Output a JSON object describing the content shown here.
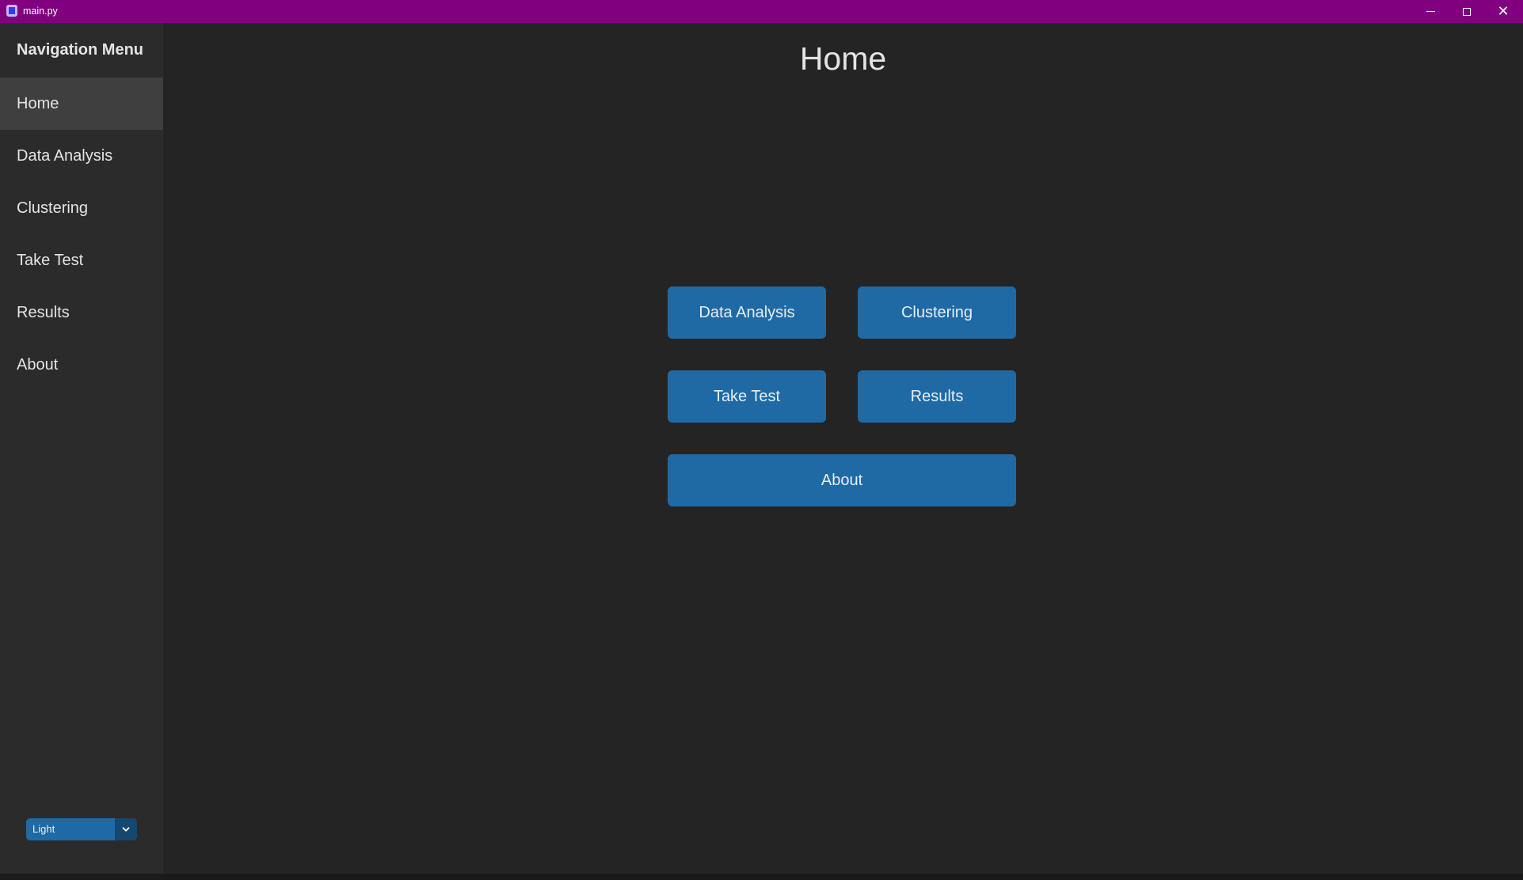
{
  "window": {
    "title": "main.py"
  },
  "sidebar": {
    "title": "Navigation Menu",
    "items": [
      {
        "label": "Home",
        "active": true
      },
      {
        "label": "Data Analysis",
        "active": false
      },
      {
        "label": "Clustering",
        "active": false
      },
      {
        "label": "Take Test",
        "active": false
      },
      {
        "label": "Results",
        "active": false
      },
      {
        "label": "About",
        "active": false
      }
    ],
    "appearance_mode": {
      "selected": "Light",
      "icon": "chevron-down-icon"
    }
  },
  "main": {
    "title": "Home",
    "buttons": {
      "data_analysis": "Data Analysis",
      "clustering": "Clustering",
      "take_test": "Take Test",
      "results": "Results",
      "about": "About"
    }
  },
  "colors": {
    "titlebar": "#800080",
    "background": "#242424",
    "sidebar": "#2b2b2b",
    "active_nav": "#3f3f3f",
    "accent": "#1f6aa5"
  }
}
